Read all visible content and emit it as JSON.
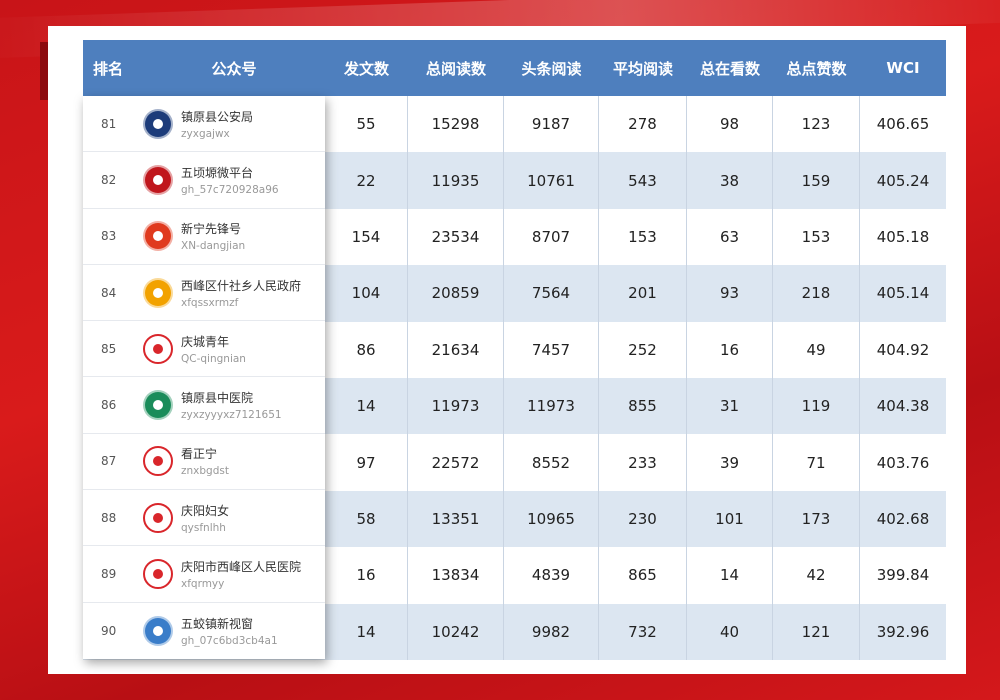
{
  "header": [
    "排名",
    "公众号",
    "发文数",
    "总阅读数",
    "头条阅读",
    "平均阅读",
    "总在看数",
    "总点赞数",
    "WCI"
  ],
  "rows": [
    {
      "rank": "81",
      "name": "镇原县公安局",
      "id": "zyxgajwx",
      "posts": "55",
      "total": "15298",
      "head": "9187",
      "avg": "278",
      "watch": "98",
      "likes": "123",
      "wci": "406.65",
      "logo": "police-badge-icon",
      "color": "#1d3c7a"
    },
    {
      "rank": "82",
      "name": "五顷塬微平台",
      "id": "gh_57c720928a96",
      "posts": "22",
      "total": "11935",
      "head": "10761",
      "avg": "543",
      "watch": "38",
      "likes": "159",
      "wci": "405.24",
      "logo": "calligraphy-seal-icon",
      "color": "#c0171d"
    },
    {
      "rank": "83",
      "name": "新宁先锋号",
      "id": "XN-dangjian",
      "posts": "154",
      "total": "23534",
      "head": "8707",
      "avg": "153",
      "watch": "63",
      "likes": "153",
      "wci": "405.18",
      "logo": "red-flag-icon",
      "color": "#e03a1e"
    },
    {
      "rank": "84",
      "name": "西峰区什社乡人民政府",
      "id": "xfqssxrmzf",
      "posts": "104",
      "total": "20859",
      "head": "7564",
      "avg": "201",
      "watch": "93",
      "likes": "218",
      "wci": "405.14",
      "logo": "national-emblem-icon",
      "color": "#f2a200"
    },
    {
      "rank": "85",
      "name": "庆城青年",
      "id": "QC-qingnian",
      "posts": "86",
      "total": "21634",
      "head": "7457",
      "avg": "252",
      "watch": "16",
      "likes": "49",
      "wci": "404.92",
      "logo": "mascot-icon",
      "color": "#ffffff"
    },
    {
      "rank": "86",
      "name": "镇原县中医院",
      "id": "zyxzyyyxz7121651",
      "posts": "14",
      "total": "11973",
      "head": "11973",
      "avg": "855",
      "watch": "31",
      "likes": "119",
      "wci": "404.38",
      "logo": "hospital-emblem-icon",
      "color": "#1a8c5a"
    },
    {
      "rank": "87",
      "name": "看正宁",
      "id": "znxbgdst",
      "posts": "97",
      "total": "22572",
      "head": "8552",
      "avg": "233",
      "watch": "39",
      "likes": "71",
      "wci": "403.76",
      "logo": "swoosh-icon",
      "color": "#ffffff"
    },
    {
      "rank": "88",
      "name": "庆阳妇女",
      "id": "qysfnlhh",
      "posts": "58",
      "total": "13351",
      "head": "10965",
      "avg": "230",
      "watch": "101",
      "likes": "173",
      "wci": "402.68",
      "logo": "womens-federation-icon",
      "color": "#ffffff"
    },
    {
      "rank": "89",
      "name": "庆阳市西峰区人民医院",
      "id": "xfqrmyy",
      "posts": "16",
      "total": "13834",
      "head": "4839",
      "avg": "865",
      "watch": "14",
      "likes": "42",
      "wci": "399.84",
      "logo": "hospital-badge-icon",
      "color": "#ffffff"
    },
    {
      "rank": "90",
      "name": "五蛟镇新视窗",
      "id": "gh_07c6bd3cb4a1",
      "posts": "14",
      "total": "10242",
      "head": "9982",
      "avg": "732",
      "watch": "40",
      "likes": "121",
      "wci": "392.96",
      "logo": "town-photo-icon",
      "color": "#3a7dc9"
    }
  ]
}
